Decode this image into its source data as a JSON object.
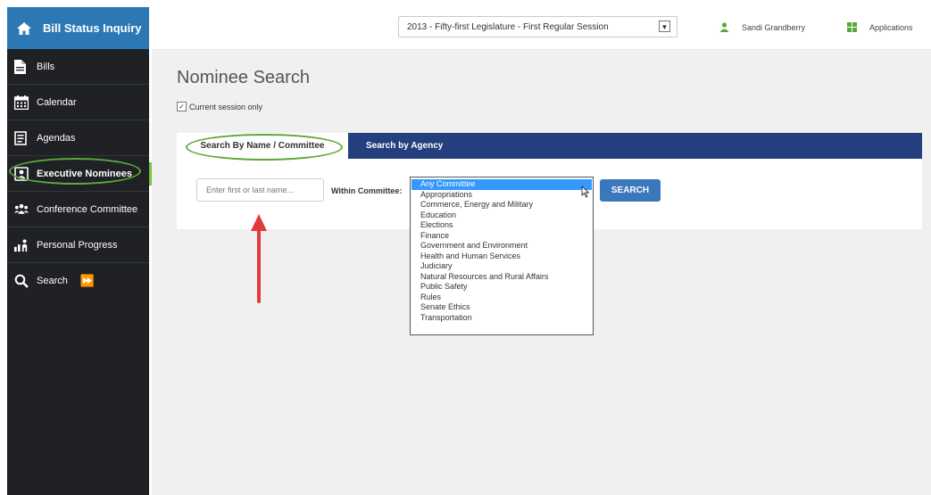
{
  "brand": {
    "title": "Bill Status Inquiry"
  },
  "sidebar": {
    "items": [
      {
        "label": "Bills",
        "icon": "document-icon"
      },
      {
        "label": "Calendar",
        "icon": "calendar-icon"
      },
      {
        "label": "Agendas",
        "icon": "agenda-icon"
      },
      {
        "label": "Executive Nominees",
        "icon": "nominee-icon"
      },
      {
        "label": "Conference Committee",
        "icon": "group-icon"
      },
      {
        "label": "Personal Progress",
        "icon": "progress-icon"
      },
      {
        "label": "Search",
        "icon": "search-icon",
        "suffix": "⏩"
      }
    ]
  },
  "header": {
    "session": "2013 - Fifty-first Legislature - First Regular Session",
    "user": "Sandi Grandberry",
    "apps": "Applications"
  },
  "main": {
    "title": "Nominee Search",
    "current_session_label": "Current session only",
    "current_session_checked": true,
    "tabs": [
      "Search By Name / Committee",
      "Search by Agency"
    ],
    "name_placeholder": "Enter first or last name...",
    "within_label": "Within Committee:",
    "search_button": "SEARCH",
    "committee_options": [
      "Any Committee",
      "Appropriations",
      "Commerce, Energy and Military",
      "Education",
      "Elections",
      "Finance",
      "Government and Environment",
      "Health and Human Services",
      "Judiciary",
      "Natural Resources and Rural Affairs",
      "Public Safety",
      "Rules",
      "Senate Ethics",
      "Transportation"
    ],
    "selected_committee": "Any Committee"
  },
  "colors": {
    "sidebar_bg": "#1f2125",
    "brand_bg": "#2c78b5",
    "tabbar_bg": "#233f7d",
    "highlight_oval": "#5aa83a",
    "search_button": "#3a77bd",
    "annotation_arrow": "#e0393e"
  }
}
